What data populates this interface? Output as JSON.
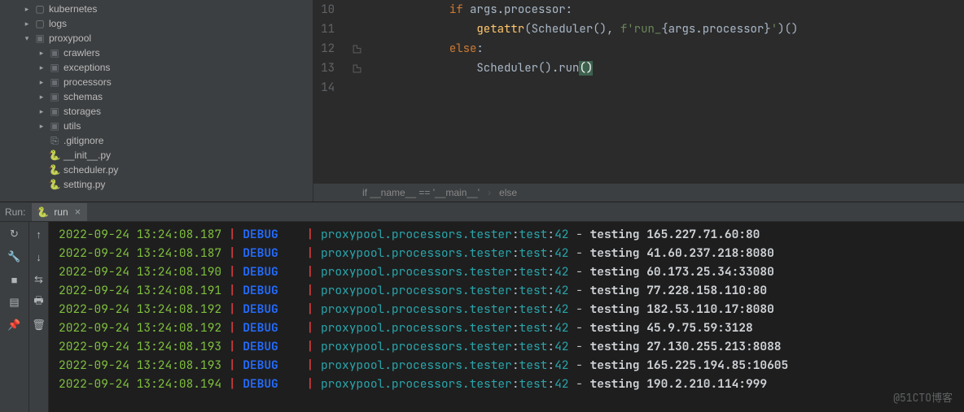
{
  "tree": [
    {
      "indent": 1,
      "arrow": ">",
      "icon": "folder-outline",
      "label": "kubernetes"
    },
    {
      "indent": 1,
      "arrow": ">",
      "icon": "folder-outline",
      "label": "logs",
      "hl": true
    },
    {
      "indent": 1,
      "arrow": "v",
      "icon": "folder-dark",
      "label": "proxypool"
    },
    {
      "indent": 2,
      "arrow": ">",
      "icon": "folder-dark",
      "label": "crawlers"
    },
    {
      "indent": 2,
      "arrow": ">",
      "icon": "folder-dark",
      "label": "exceptions"
    },
    {
      "indent": 2,
      "arrow": ">",
      "icon": "folder-dark",
      "label": "processors"
    },
    {
      "indent": 2,
      "arrow": ">",
      "icon": "folder-dark",
      "label": "schemas"
    },
    {
      "indent": 2,
      "arrow": ">",
      "icon": "folder-dark",
      "label": "storages"
    },
    {
      "indent": 2,
      "arrow": ">",
      "icon": "folder-dark",
      "label": "utils"
    },
    {
      "indent": 2,
      "arrow": "",
      "icon": "file",
      "label": ".gitignore"
    },
    {
      "indent": 2,
      "arrow": "",
      "icon": "py",
      "label": "__init__.py"
    },
    {
      "indent": 2,
      "arrow": "",
      "icon": "py",
      "label": "scheduler.py"
    },
    {
      "indent": 2,
      "arrow": "",
      "icon": "py",
      "label": "setting.py"
    }
  ],
  "code": {
    "lines": [
      {
        "n": 10,
        "segments": [
          [
            "kw",
            "if "
          ],
          [
            "call",
            "args"
          ],
          [
            "call",
            "."
          ],
          [
            "call",
            "processor"
          ],
          [
            "call",
            ":"
          ]
        ],
        "indent": 3
      },
      {
        "n": 11,
        "segments": [
          [
            "fn",
            "getattr"
          ],
          [
            "paren",
            "("
          ],
          [
            "call",
            "Scheduler"
          ],
          [
            "paren",
            "()"
          ],
          [
            "call",
            ", "
          ],
          [
            "strprefix",
            "f"
          ],
          [
            "str",
            "'run_"
          ],
          [
            "paren",
            "{"
          ],
          [
            "call",
            "args"
          ],
          [
            "call",
            "."
          ],
          [
            "call",
            "processor"
          ],
          [
            "paren",
            "}"
          ],
          [
            "str",
            "'"
          ],
          [
            "paren",
            ")()"
          ]
        ],
        "indent": 4
      },
      {
        "n": 12,
        "segments": [
          [
            "kw",
            "else"
          ],
          [
            "call",
            ":"
          ]
        ],
        "indent": 3,
        "gutIcon": true
      },
      {
        "n": 13,
        "segments": [
          [
            "call",
            "Scheduler"
          ],
          [
            "paren",
            "()"
          ],
          [
            "call",
            "."
          ],
          [
            "call",
            "run"
          ],
          [
            "hlparen",
            "()"
          ]
        ],
        "indent": 4,
        "gutIcon": true
      },
      {
        "n": 14,
        "segments": [],
        "indent": 0
      }
    ]
  },
  "breadcrumb": [
    "if __name__ == '__main__'",
    "else"
  ],
  "run": {
    "label": "Run:",
    "tab": "run"
  },
  "logs": [
    {
      "ts": "2022-09-24 13:24:08.187",
      "lvl": "DEBUG",
      "mod": "proxypool.processors.tester",
      "fn": "test",
      "ln": "42",
      "msg": "testing",
      "addr": "165.227.71.60:80"
    },
    {
      "ts": "2022-09-24 13:24:08.187",
      "lvl": "DEBUG",
      "mod": "proxypool.processors.tester",
      "fn": "test",
      "ln": "42",
      "msg": "testing",
      "addr": "41.60.237.218:8080"
    },
    {
      "ts": "2022-09-24 13:24:08.190",
      "lvl": "DEBUG",
      "mod": "proxypool.processors.tester",
      "fn": "test",
      "ln": "42",
      "msg": "testing",
      "addr": "60.173.25.34:33080"
    },
    {
      "ts": "2022-09-24 13:24:08.191",
      "lvl": "DEBUG",
      "mod": "proxypool.processors.tester",
      "fn": "test",
      "ln": "42",
      "msg": "testing",
      "addr": "77.228.158.110:80"
    },
    {
      "ts": "2022-09-24 13:24:08.192",
      "lvl": "DEBUG",
      "mod": "proxypool.processors.tester",
      "fn": "test",
      "ln": "42",
      "msg": "testing",
      "addr": "182.53.110.17:8080"
    },
    {
      "ts": "2022-09-24 13:24:08.192",
      "lvl": "DEBUG",
      "mod": "proxypool.processors.tester",
      "fn": "test",
      "ln": "42",
      "msg": "testing",
      "addr": "45.9.75.59:3128"
    },
    {
      "ts": "2022-09-24 13:24:08.193",
      "lvl": "DEBUG",
      "mod": "proxypool.processors.tester",
      "fn": "test",
      "ln": "42",
      "msg": "testing",
      "addr": "27.130.255.213:8088"
    },
    {
      "ts": "2022-09-24 13:24:08.193",
      "lvl": "DEBUG",
      "mod": "proxypool.processors.tester",
      "fn": "test",
      "ln": "42",
      "msg": "testing",
      "addr": "165.225.194.85:10605"
    },
    {
      "ts": "2022-09-24 13:24:08.194",
      "lvl": "DEBUG",
      "mod": "proxypool.processors.tester",
      "fn": "test",
      "ln": "42",
      "msg": "testing",
      "addr": "190.2.210.114:999"
    }
  ],
  "watermark": "@51CTO博客"
}
